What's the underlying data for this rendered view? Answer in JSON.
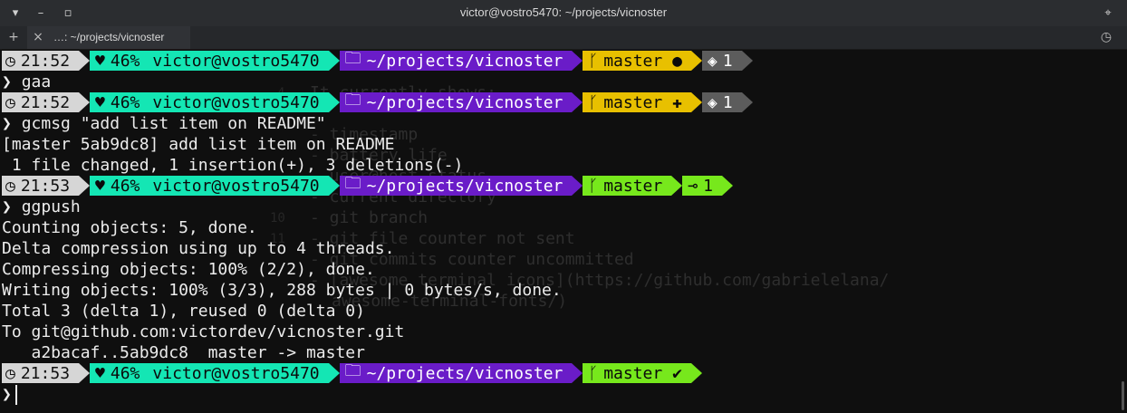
{
  "window": {
    "title": "victor@vostro5470: ~/projects/vicnoster",
    "tab_label": "…: ~/projects/vicnoster"
  },
  "prompts": [
    {
      "time": "21:52",
      "battery": "46%",
      "user": "victor@vostro5470",
      "dir": "~/projects/vicnoster",
      "branch": "master",
      "git_state": "●",
      "count": "1",
      "count_icon": "◈",
      "style": "dirty"
    },
    {
      "time": "21:52",
      "battery": "46%",
      "user": "victor@vostro5470",
      "dir": "~/projects/vicnoster",
      "branch": "master",
      "git_state": "✚",
      "count": "1",
      "count_icon": "◈",
      "style": "dirty"
    },
    {
      "time": "21:53",
      "battery": "46%",
      "user": "victor@vostro5470",
      "dir": "~/projects/vicnoster",
      "branch": "master",
      "git_state": "",
      "count": "1",
      "count_icon": "⊸",
      "style": "clean"
    },
    {
      "time": "21:53",
      "battery": "46%",
      "user": "victor@vostro5470",
      "dir": "~/projects/vicnoster",
      "branch": "master",
      "git_state": "✔",
      "count": "",
      "count_icon": "",
      "style": "clean"
    }
  ],
  "commands": {
    "c1": "gaa",
    "c2": "gcmsg \"add list item on README\"",
    "c3": "ggpush"
  },
  "output": {
    "commit1": "[master 5ab9dc8] add list item on README",
    "commit2": " 1 file changed, 1 insertion(+), 3 deletions(-)",
    "push": [
      "Counting objects: 5, done.",
      "Delta compression using up to 4 threads.",
      "Compressing objects: 100% (2/2), done.",
      "Writing objects: 100% (3/3), 288 bytes | 0 bytes/s, done.",
      "Total 3 (delta 1), reused 0 (delta 0)",
      "To git@github.com:victordev/vicnoster.git",
      "   a2bacaf..5ab9dc8  master -> master"
    ]
  },
  "background_editor": {
    "lines": [
      {
        "num": "4",
        "text": "It currently shows:"
      },
      {
        "num": "",
        "text": "- timestamp"
      },
      {
        "num": "",
        "text": "- battery life"
      },
      {
        "num": "",
        "text": "- user@host status"
      },
      {
        "num": "",
        "text": "- current directory"
      },
      {
        "num": "10",
        "text": "- git branch"
      },
      {
        "num": "11",
        "text": "- git file counter not sent"
      },
      {
        "num": "",
        "text": "- git commits counter uncommitted"
      },
      {
        "num": "",
        "text": "- [awesome terminal icons](https://github.com/gabrielelana/"
      },
      {
        "num": "",
        "text": "awesome-terminal-fonts/)"
      }
    ]
  },
  "prompt_symbol": "❯",
  "icons": {
    "clock": "clock-icon",
    "heart": "heart-icon",
    "folder": "folder-icon",
    "branch": "git-branch-icon"
  }
}
